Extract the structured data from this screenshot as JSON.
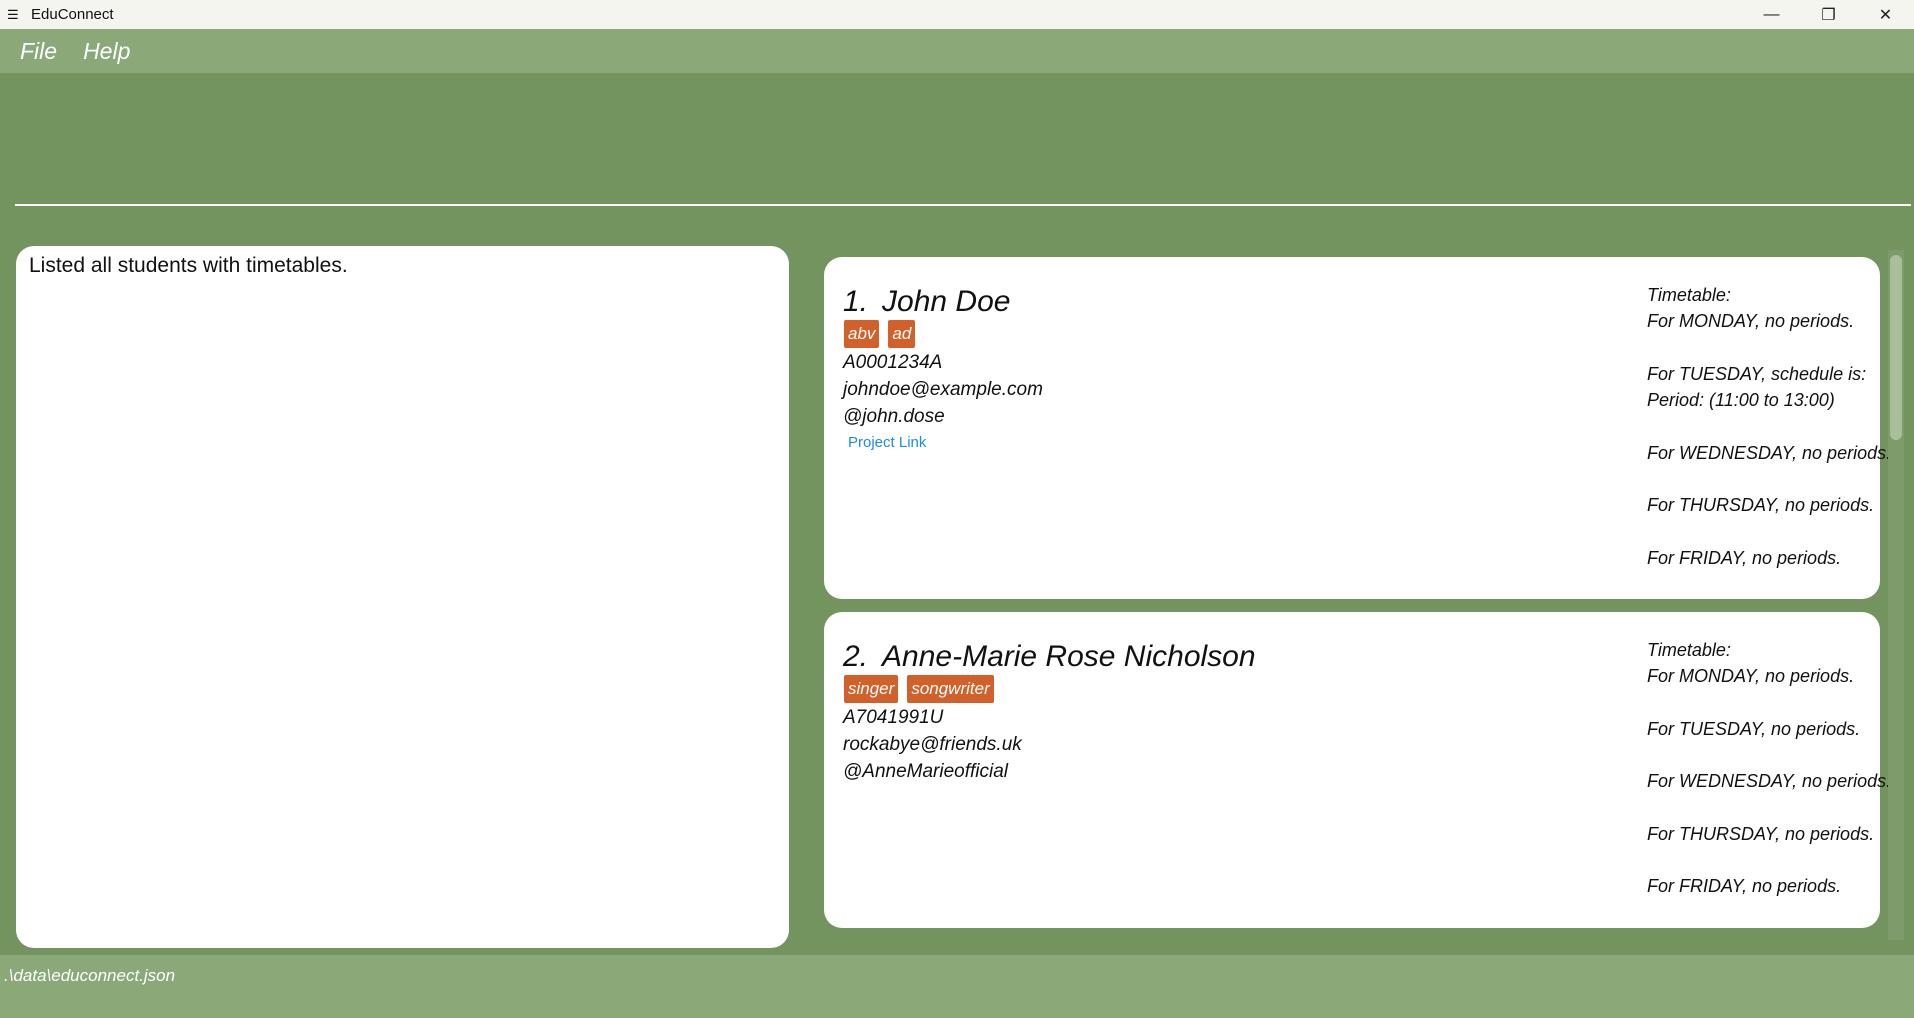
{
  "window": {
    "title": "EduConnect",
    "controls": [
      "—",
      "❐",
      "✕"
    ]
  },
  "menu": {
    "file": "File",
    "help": "Help"
  },
  "command": {
    "value": "",
    "placeholder": ""
  },
  "result": {
    "text": "Listed all students with timetables."
  },
  "students": [
    {
      "index": "1.",
      "name": "John Doe",
      "tags": [
        "abv",
        "ad"
      ],
      "student_id": "A0001234A",
      "email": "johndoe@example.com",
      "handle": "@john.dose",
      "link_label": "Project Link",
      "timetable": [
        "Timetable:",
        "For MONDAY, no periods.",
        "For TUESDAY, schedule is:",
        "Period: (11:00 to 13:00)",
        "For WEDNESDAY, no periods.",
        "For THURSDAY, no periods.",
        "For FRIDAY, no periods."
      ]
    },
    {
      "index": "2.",
      "name": "Anne-Marie Rose Nicholson",
      "tags": [
        "singer",
        "songwriter"
      ],
      "student_id": "A7041991U",
      "email": "rockabye@friends.uk",
      "handle": "@AnneMarieofficial",
      "timetable": [
        "Timetable:",
        "For MONDAY, no periods.",
        "For TUESDAY, no periods.",
        "For WEDNESDAY, no periods.",
        "For THURSDAY, no periods.",
        "For FRIDAY, no periods."
      ]
    }
  ],
  "status": {
    "path": ".\\data\\educonnect.json"
  }
}
